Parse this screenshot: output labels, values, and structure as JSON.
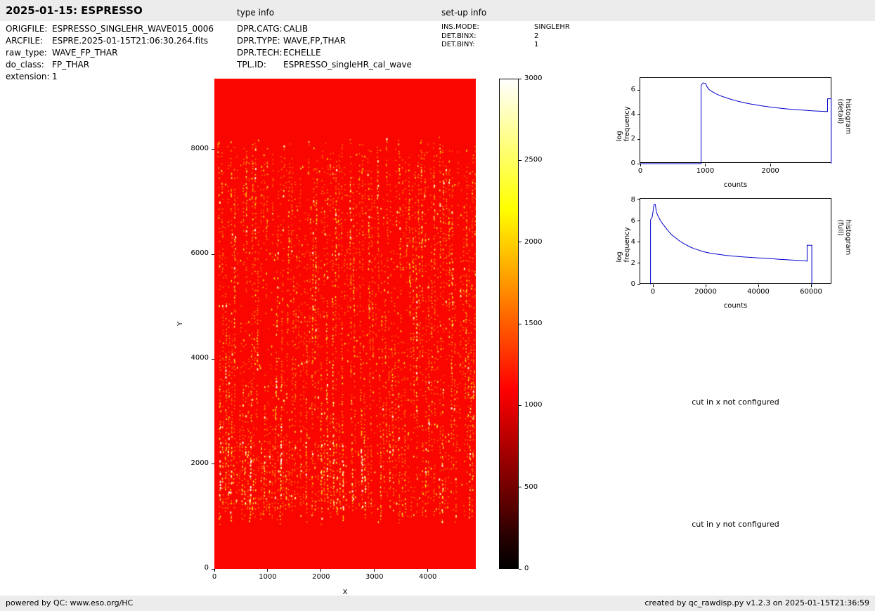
{
  "header": {
    "title": "2025-01-15: ESPRESSO",
    "type_info_label": "type info",
    "setup_info_label": "set-up info"
  },
  "file_info": {
    "rows": [
      {
        "label": "ORIGFILE:",
        "value": "ESPRESSO_SINGLEHR_WAVE015_0006"
      },
      {
        "label": "ARCFILE:",
        "value": "ESPRE.2025-01-15T21:06:30.264.fits"
      },
      {
        "label": "raw_type:",
        "value": "WAVE_FP_THAR"
      },
      {
        "label": "do_class:",
        "value": "FP_THAR"
      },
      {
        "label": "extension:",
        "value": "1"
      }
    ]
  },
  "type_info": {
    "rows": [
      {
        "label": "DPR.CATG:",
        "value": "CALIB"
      },
      {
        "label": "DPR.TYPE:",
        "value": "WAVE,FP,THAR"
      },
      {
        "label": "DPR.TECH:",
        "value": "ECHELLE"
      },
      {
        "label": "TPL.ID:",
        "value": "ESPRESSO_singleHR_cal_wave"
      }
    ]
  },
  "setup_info": {
    "rows": [
      {
        "label": "INS.MODE:",
        "value": "SINGLEHR"
      },
      {
        "label": "DET.BINX:",
        "value": "2"
      },
      {
        "label": "DET.BINY:",
        "value": "1"
      }
    ]
  },
  "messages": {
    "cut_x": "cut in x not configured",
    "cut_y": "cut in y not configured"
  },
  "footer": {
    "left": "powered by QC: www.eso.org/HC",
    "right": "created by qc_rawdisp.py v1.2.3 on 2025-01-15T21:36:59"
  },
  "chart_data": [
    {
      "id": "detector-image",
      "type": "heatmap",
      "xlabel": "X",
      "ylabel": "Y",
      "xlim": [
        0,
        4900
      ],
      "ylim": [
        0,
        9350
      ],
      "xticks": [
        0,
        1000,
        2000,
        3000,
        4000
      ],
      "yticks": [
        0,
        2000,
        4000,
        6000,
        8000
      ],
      "colormap": "hot",
      "vmin": 0,
      "vmax": 3000,
      "description": "raw WAVE,FP,THAR frame: uniform red background with vertical dotted echelle-order stripes of brighter yellow/white emission-line speckles between y~1000 and y~8200, brightest clusters in lower-left region"
    },
    {
      "id": "colorbar",
      "type": "colorbar",
      "colormap": "hot",
      "vmin": 0,
      "vmax": 3000,
      "ticks": [
        0,
        500,
        1000,
        1500,
        2000,
        2500,
        3000
      ]
    },
    {
      "id": "histogram-detail",
      "type": "line",
      "right_label": "histogram (detail)",
      "xlabel": "counts",
      "ylabel": "log frequency",
      "color": "#0000cc",
      "xlim": [
        0,
        2950
      ],
      "ylim": [
        0,
        7
      ],
      "xticks": [
        0,
        1000,
        2000
      ],
      "yticks": [
        0,
        2,
        4,
        6
      ],
      "points": [
        [
          0,
          0
        ],
        [
          935,
          0
        ],
        [
          935,
          6.4
        ],
        [
          965,
          6.6
        ],
        [
          1005,
          6.55
        ],
        [
          1030,
          6.25
        ],
        [
          1060,
          6.05
        ],
        [
          1100,
          5.9
        ],
        [
          1160,
          5.72
        ],
        [
          1230,
          5.55
        ],
        [
          1300,
          5.42
        ],
        [
          1380,
          5.28
        ],
        [
          1460,
          5.15
        ],
        [
          1540,
          5.05
        ],
        [
          1620,
          4.95
        ],
        [
          1700,
          4.87
        ],
        [
          1780,
          4.8
        ],
        [
          1860,
          4.73
        ],
        [
          1940,
          4.67
        ],
        [
          2020,
          4.61
        ],
        [
          2100,
          4.56
        ],
        [
          2180,
          4.51
        ],
        [
          2260,
          4.47
        ],
        [
          2340,
          4.43
        ],
        [
          2420,
          4.4
        ],
        [
          2500,
          4.37
        ],
        [
          2580,
          4.34
        ],
        [
          2660,
          4.31
        ],
        [
          2740,
          4.29
        ],
        [
          2820,
          4.27
        ],
        [
          2880,
          4.26
        ],
        [
          2880,
          5.3
        ],
        [
          2935,
          5.3
        ],
        [
          2935,
          0
        ]
      ]
    },
    {
      "id": "histogram-full",
      "type": "line",
      "right_label": "histogram (full)",
      "xlabel": "counts",
      "ylabel": "log frequency",
      "color": "#0000cc",
      "xlim": [
        -4800,
        68000
      ],
      "ylim": [
        0,
        8.1
      ],
      "xticks": [
        0,
        20000,
        40000,
        60000
      ],
      "yticks": [
        0,
        2,
        4,
        6,
        8
      ],
      "points": [
        [
          -900,
          0
        ],
        [
          -900,
          6.1
        ],
        [
          -300,
          6.35
        ],
        [
          100,
          7.0
        ],
        [
          400,
          7.55
        ],
        [
          900,
          7.55
        ],
        [
          1300,
          6.85
        ],
        [
          1900,
          6.5
        ],
        [
          2500,
          6.2
        ],
        [
          3100,
          5.95
        ],
        [
          3700,
          5.72
        ],
        [
          4400,
          5.5
        ],
        [
          5200,
          5.25
        ],
        [
          6000,
          5.0
        ],
        [
          6800,
          4.78
        ],
        [
          7600,
          4.6
        ],
        [
          8500,
          4.42
        ],
        [
          9500,
          4.22
        ],
        [
          10500,
          4.05
        ],
        [
          11500,
          3.9
        ],
        [
          12500,
          3.75
        ],
        [
          14000,
          3.55
        ],
        [
          15500,
          3.4
        ],
        [
          17000,
          3.27
        ],
        [
          18500,
          3.15
        ],
        [
          20000,
          3.05
        ],
        [
          22000,
          2.95
        ],
        [
          24000,
          2.87
        ],
        [
          26000,
          2.8
        ],
        [
          28000,
          2.74
        ],
        [
          30000,
          2.69
        ],
        [
          32000,
          2.65
        ],
        [
          34000,
          2.61
        ],
        [
          36000,
          2.57
        ],
        [
          38000,
          2.54
        ],
        [
          40000,
          2.51
        ],
        [
          42000,
          2.48
        ],
        [
          44000,
          2.45
        ],
        [
          46000,
          2.42
        ],
        [
          48000,
          2.38
        ],
        [
          50000,
          2.35
        ],
        [
          52000,
          2.32
        ],
        [
          54000,
          2.29
        ],
        [
          56000,
          2.26
        ],
        [
          58000,
          2.23
        ],
        [
          58500,
          2.2
        ],
        [
          58500,
          3.7
        ],
        [
          60300,
          3.7
        ],
        [
          60300,
          0
        ]
      ]
    }
  ]
}
